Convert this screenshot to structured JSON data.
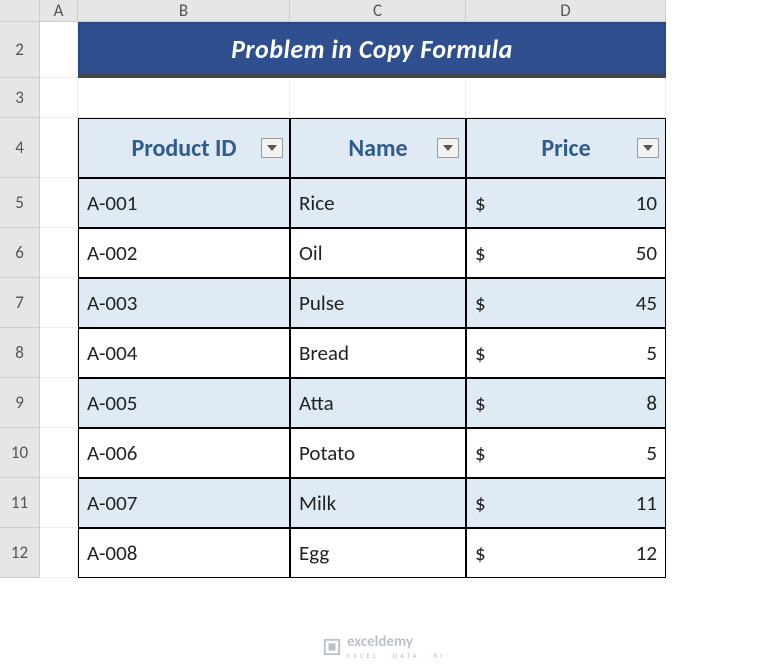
{
  "columns": [
    "A",
    "B",
    "C",
    "D"
  ],
  "rows": [
    "2",
    "3",
    "4",
    "5",
    "6",
    "7",
    "8",
    "9",
    "10",
    "11",
    "12"
  ],
  "title": "Problem in Copy Formula",
  "headers": {
    "b": "Product ID",
    "c": "Name",
    "d": "Price"
  },
  "currency": "$",
  "data": [
    {
      "id": "A-001",
      "name": "Rice",
      "price": "10"
    },
    {
      "id": "A-002",
      "name": "Oil",
      "price": "50"
    },
    {
      "id": "A-003",
      "name": "Pulse",
      "price": "45"
    },
    {
      "id": "A-004",
      "name": "Bread",
      "price": "5"
    },
    {
      "id": "A-005",
      "name": "Atta",
      "price": "8"
    },
    {
      "id": "A-006",
      "name": "Potato",
      "price": "5"
    },
    {
      "id": "A-007",
      "name": "Milk",
      "price": "11"
    },
    {
      "id": "A-008",
      "name": "Egg",
      "price": "12"
    }
  ],
  "watermark": {
    "name": "exceldemy",
    "sub": "EXCEL · DATA · BI"
  },
  "chart_data": {
    "type": "table",
    "title": "Problem in Copy Formula",
    "columns": [
      "Product ID",
      "Name",
      "Price"
    ],
    "rows": [
      [
        "A-001",
        "Rice",
        10
      ],
      [
        "A-002",
        "Oil",
        50
      ],
      [
        "A-003",
        "Pulse",
        45
      ],
      [
        "A-004",
        "Bread",
        5
      ],
      [
        "A-005",
        "Atta",
        8
      ],
      [
        "A-006",
        "Potato",
        5
      ],
      [
        "A-007",
        "Milk",
        11
      ],
      [
        "A-008",
        "Egg",
        12
      ]
    ]
  }
}
